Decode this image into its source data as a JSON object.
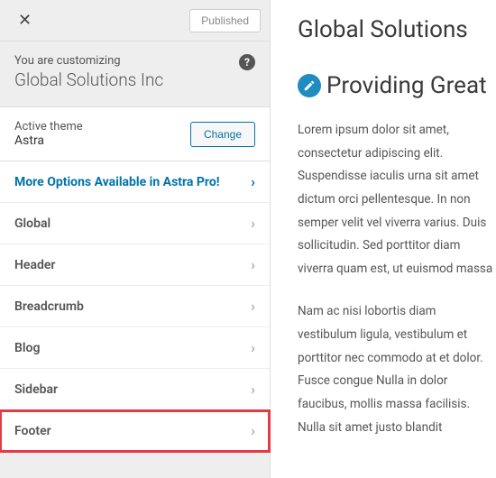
{
  "topbar": {
    "close_glyph": "✕",
    "published_label": "Published"
  },
  "customizing": {
    "label": "You are customizing",
    "site_title": "Global Solutions Inc",
    "help_glyph": "?"
  },
  "theme": {
    "label": "Active theme",
    "name": "Astra",
    "change_label": "Change"
  },
  "menu": {
    "pro_label": "More Options Available in Astra Pro!",
    "items": [
      {
        "label": "Global"
      },
      {
        "label": "Header"
      },
      {
        "label": "Breadcrumb"
      },
      {
        "label": "Blog"
      },
      {
        "label": "Sidebar"
      },
      {
        "label": "Footer"
      }
    ]
  },
  "preview": {
    "site_name": "Global Solutions",
    "heading": "Providing Great",
    "para1": "Lorem ipsum dolor sit amet, consectetur adipiscing elit. Suspendisse iaculis urna sit amet dictum orci pellentesque. In non semper velit vel viverra varius. Duis sollicitudin. Sed porttitor diam viverra quam est, ut euismod massa",
    "para2": "Nam ac nisi lobortis diam vestibulum ligula, vestibulum et porttitor nec commodo at et dolor. Fusce congue Nulla in dolor faucibus, mollis massa facilisis. Nulla sit amet justo blandit"
  }
}
